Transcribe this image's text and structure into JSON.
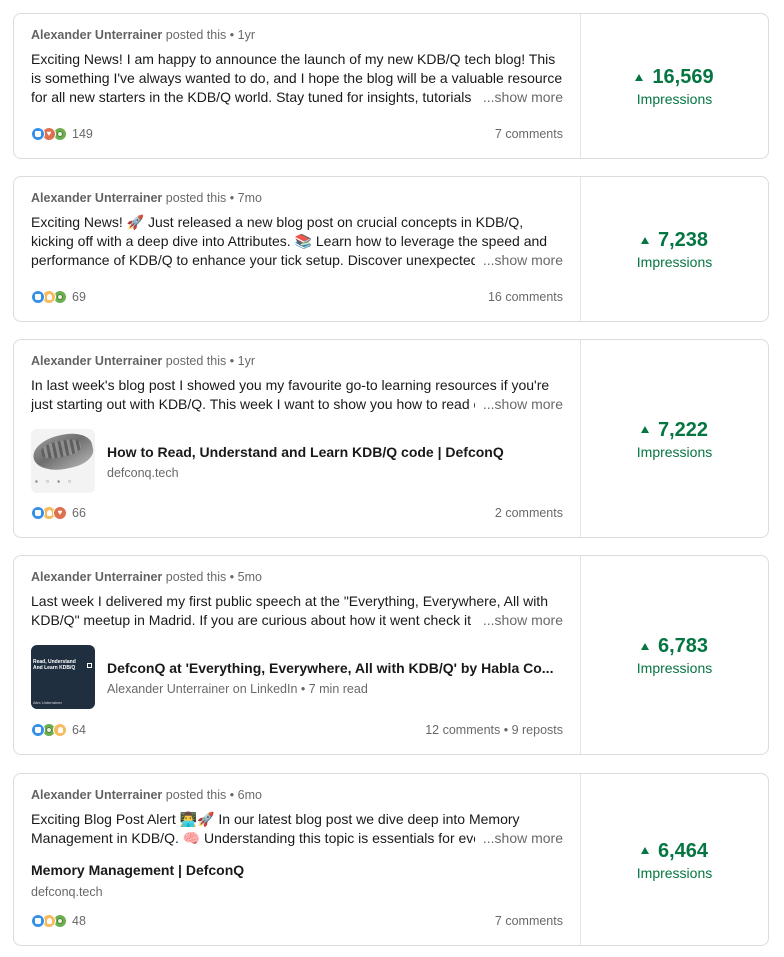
{
  "posts": [
    {
      "author": "Alexander Unterrainer",
      "posted": "posted this",
      "age": "1yr",
      "text": "Exciting News! I am happy to announce the launch of my new KDB/Q tech blog! This is something I've always wanted to do, and I hope the blog will be a valuable resource for all new starters in the KDB/Q world. Stay tuned for insights, tutorials and more!",
      "show_more": "...show more",
      "reactions": [
        "like-icon",
        "love-icon",
        "celebrate-icon"
      ],
      "reaction_count": "149",
      "engagement": "7 comments",
      "impressions": "16,569",
      "impressions_label": "Impressions"
    },
    {
      "author": "Alexander Unterrainer",
      "posted": "posted this",
      "age": "7mo",
      "text": "Exciting News! 🚀 Just released a new blog post on crucial concepts in KDB/Q, kicking off with a deep dive into Attributes. 📚 Learn how to leverage the speed and performance of KDB/Q to enhance your tick setup. Discover unexpected insights!",
      "show_more": "...show more",
      "reactions": [
        "like-icon",
        "insightful-icon",
        "celebrate-icon"
      ],
      "reaction_count": "69",
      "engagement": "16 comments",
      "impressions": "7,238",
      "impressions_label": "Impressions"
    },
    {
      "author": "Alexander Unterrainer",
      "posted": "posted this",
      "age": "1yr",
      "text": "In last week's blog post I showed you my favourite go-to learning resources if you're just starting out with KDB/Q. This week I want to show you how to read code.",
      "show_more": "...show more",
      "link_title": "How to Read, Understand and Learn KDB/Q code | DefconQ",
      "link_sub": "defconq.tech",
      "reactions": [
        "like-icon",
        "insightful-icon",
        "love-icon"
      ],
      "reaction_count": "66",
      "engagement": "2 comments",
      "impressions": "7,222",
      "impressions_label": "Impressions"
    },
    {
      "author": "Alexander Unterrainer",
      "posted": "posted this",
      "age": "5mo",
      "text": "Last week I delivered my first public speech at the \"Everything, Everywhere, All with KDB/Q\" meetup in Madrid. If you are curious about how it went check it out.",
      "show_more": "...show more",
      "thumb_title": "Read, Understand And Learn KDB/Q",
      "thumb_author": "Alex Unterrainer",
      "link_title": "DefconQ at 'Everything, Everywhere, All with KDB/Q' by Habla Co...",
      "link_sub": "Alexander Unterrainer on LinkedIn • 7 min read",
      "reactions": [
        "like-icon",
        "celebrate-icon",
        "insightful-icon"
      ],
      "reaction_count": "64",
      "engagement": "12 comments • 9 reposts",
      "impressions": "6,783",
      "impressions_label": "Impressions"
    },
    {
      "author": "Alexander Unterrainer",
      "posted": "posted this",
      "age": "6mo",
      "text": "Exciting Blog Post Alert 👨‍💻🚀 In our latest blog post we dive deep into Memory Management in KDB/Q. 🧠 Understanding this topic is essentials for every developer.",
      "show_more": "...show more",
      "link_title": "Memory Management | DefconQ",
      "link_sub": "defconq.tech",
      "reactions": [
        "like-icon",
        "insightful-icon",
        "celebrate-icon"
      ],
      "reaction_count": "48",
      "engagement": "7 comments",
      "impressions": "6,464",
      "impressions_label": "Impressions"
    }
  ],
  "colors": {
    "accent": "#057642",
    "like": "#378fe9",
    "love": "#df704d",
    "celebrate": "#6dae4f",
    "insightful": "#f5bb5c"
  }
}
